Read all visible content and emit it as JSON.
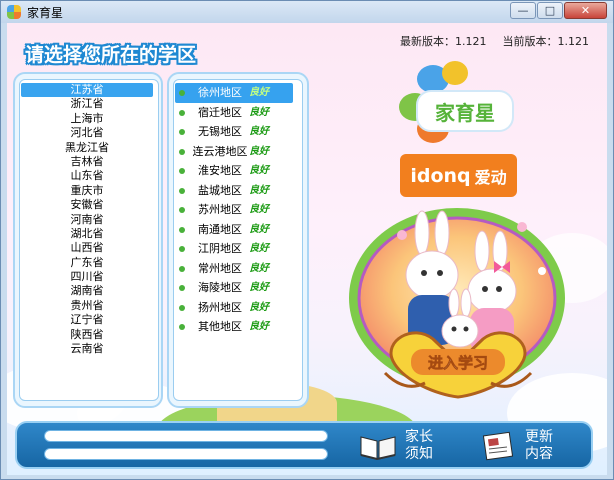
{
  "window": {
    "title": "家育星",
    "min_glyph": "—",
    "max_glyph": "□",
    "close_glyph": "✕"
  },
  "version": {
    "latest": "最新版本：1.121",
    "current": "当前版本：1.121"
  },
  "heading": "请选择您所在的学区",
  "provinces": {
    "selected_index": 0,
    "items": [
      "江苏省",
      "浙江省",
      "上海市",
      "河北省",
      "黑龙江省",
      "吉林省",
      "山东省",
      "重庆市",
      "安徽省",
      "河南省",
      "湖北省",
      "山西省",
      "广东省",
      "四川省",
      "湖南省",
      "贵州省",
      "辽宁省",
      "陕西省",
      "云南省"
    ]
  },
  "regions": {
    "selected_index": 0,
    "items": [
      {
        "name": "徐州地区",
        "tag": "良好"
      },
      {
        "name": "宿迁地区",
        "tag": "良好"
      },
      {
        "name": "无锡地区",
        "tag": "良好"
      },
      {
        "name": "连云港地区",
        "tag": "良好"
      },
      {
        "name": "淮安地区",
        "tag": "良好"
      },
      {
        "name": "盐城地区",
        "tag": "良好"
      },
      {
        "name": "苏州地区",
        "tag": "良好"
      },
      {
        "name": "南通地区",
        "tag": "良好"
      },
      {
        "name": "江阴地区",
        "tag": "良好"
      },
      {
        "name": "常州地区",
        "tag": "良好"
      },
      {
        "name": "海陵地区",
        "tag": "良好"
      },
      {
        "name": "扬州地区",
        "tag": "良好"
      },
      {
        "name": "其他地区",
        "tag": "良好"
      }
    ]
  },
  "brand": {
    "logo_text": "家育星",
    "idong_text": "idonq",
    "idong_cn": "爱动"
  },
  "enter_button": {
    "label": "进入学习"
  },
  "bottom": {
    "notice_label_1": "家长",
    "notice_label_2": "须知",
    "update_label_1": "更新",
    "update_label_2": "内容"
  },
  "colors": {
    "accent": "#1e88d2",
    "selected": "#39a4ef",
    "tag_green": "#1c9b14",
    "brand_orange": "#f27f1e"
  }
}
